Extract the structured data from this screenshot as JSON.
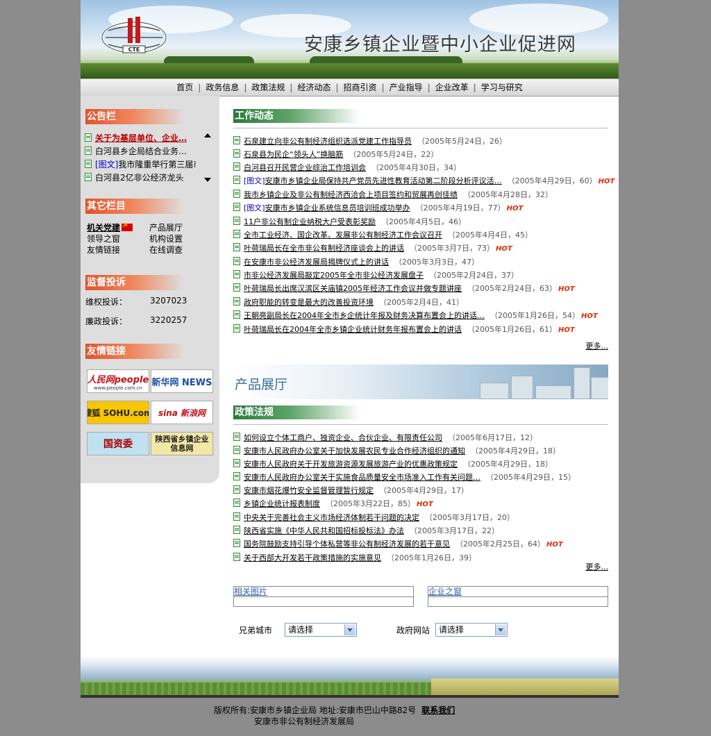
{
  "header": {
    "site_title": "安康乡镇企业暨中小企业促进网",
    "logo_text": "CTE"
  },
  "nav": [
    "首页",
    "政务信息",
    "政策法规",
    "经济动态",
    "招商引资",
    "产业指导",
    "企业改革",
    "学习与研究"
  ],
  "sidebar": {
    "notice_title": "公告栏",
    "notices": [
      {
        "tag": "",
        "text": "关于为基层单位、企业…",
        "highlight": true
      },
      {
        "tag": "",
        "text": "白河县乡企局结合业务…",
        "highlight": false
      },
      {
        "tag": "[图文]",
        "text": "我市隆重举行第三届市…",
        "highlight": false
      },
      {
        "tag": "",
        "text": "白河县2亿非公经济龙头",
        "highlight": false
      }
    ],
    "other_title": "其它栏目",
    "other_links": [
      "机关党建",
      "产品展厅",
      "领导之窗",
      "机构设置",
      "友情链接",
      "在线调查"
    ],
    "supervise_title": "监督投诉",
    "supervise": [
      {
        "label": "维权投诉：",
        "value": "3207023"
      },
      {
        "label": "廉政投诉：",
        "value": "3220257"
      }
    ],
    "friend_title": "友情链接",
    "friend_links": [
      "人民网people",
      "新华网 NEWS",
      "搜狐 SOHU.com",
      "sina 新浪网",
      "国资委",
      "陕西省乡镇企业信息网"
    ],
    "friend_sub": [
      "www.people.com.cn"
    ]
  },
  "economy": {
    "title": "工作动态",
    "items": [
      {
        "tag": "",
        "title": "石泉建立向非公有制经济组织选派党建工作指导员",
        "meta": "（2005年5月24日，26）",
        "hot": false
      },
      {
        "tag": "",
        "title": "石泉县为民企“领头人”换脑筋",
        "meta": "（2005年5月24日，22）",
        "hot": false
      },
      {
        "tag": "",
        "title": "白河县召开民营企业综治工作培训会",
        "meta": "（2005年4月30日，34）",
        "hot": false
      },
      {
        "tag": "[图文]",
        "title": "安康市乡镇企业局保持共产党员先进性教育活动第二阶段分析评议活…",
        "meta": "（2005年4月29日，60）",
        "hot": true
      },
      {
        "tag": "",
        "title": "我市乡镇企业及非公有制经济西洽会上项目签约和贸展再创佳绩",
        "meta": "（2005年4月28日，32）",
        "hot": false
      },
      {
        "tag": "[图文]",
        "title": "安康市乡镇企业系统信息员培训班成功举办",
        "meta": "（2005年4月19日，77）",
        "hot": true
      },
      {
        "tag": "",
        "title": "11户非公有制企业纳税大户受表彰奖励",
        "meta": "（2005年4月5日，46）",
        "hot": false
      },
      {
        "tag": "",
        "title": "全市工业经济、国企改革、发展非公有制经济工作会议召开",
        "meta": "（2005年4月4日，45）",
        "hot": false
      },
      {
        "tag": "",
        "title": "叶荷瑞局长在全市非公有制经济座谈会上的讲话",
        "meta": "（2005年3月7日，73）",
        "hot": true
      },
      {
        "tag": "",
        "title": "在安康市非公经济发展局揭牌仪式上的讲话",
        "meta": "（2005年3月3日，47）",
        "hot": false
      },
      {
        "tag": "",
        "title": "市非公经济发展局敲定2005年全市非公经济发展盘子",
        "meta": "（2005年2月24日，37）",
        "hot": false
      },
      {
        "tag": "",
        "title": "叶荷瑞局长出席汉滨区关庙镇2005年经济工作会议并做专题讲座",
        "meta": "（2005年2月24日，63）",
        "hot": true
      },
      {
        "tag": "",
        "title": "政府职能的转变是最大的改善投资环境",
        "meta": "（2005年2月4日，41）",
        "hot": false
      },
      {
        "tag": "",
        "title": "王朝亮副局长在2004年全市乡企统计年报及财务决算布置会上的讲话…",
        "meta": "（2005年1月26日，54）",
        "hot": true
      },
      {
        "tag": "",
        "title": "叶荷瑞局长在2004年全市乡镇企业统计财务年报布置会上的讲话",
        "meta": "（2005年1月26日，61）",
        "hot": true
      }
    ],
    "more": "更多..."
  },
  "product": {
    "title": "产品展厅"
  },
  "policy": {
    "title": "政策法规",
    "items": [
      {
        "title": "如何设立个体工商户、独资企业、合伙企业、有限责任公司",
        "meta": "（2005年6月17日，12）",
        "hot": false
      },
      {
        "title": "安康市人民政府办公室关于加快发展农民专业合作经济组织的通知",
        "meta": "（2005年4月29日，18）",
        "hot": false
      },
      {
        "title": "安康市人民政府关于开发旅游资源发展旅游产业的优惠政策规定",
        "meta": "（2005年4月29日，18）",
        "hot": false
      },
      {
        "title": "安康市人民政府办公室关于实施食品质量安全市场准入工作有关问题…",
        "meta": "（2005年4月29日，15）",
        "hot": false
      },
      {
        "title": "安康市烟花爆竹安全监督管理暂行规定",
        "meta": "（2005年4月29日，17）",
        "hot": false
      },
      {
        "title": "乡镇企业统计报表制度",
        "meta": "（2005年3月22日，85）",
        "hot": true
      },
      {
        "title": "中央关于完善社会主义市场经济体制若干问题的决定",
        "meta": "（2005年3月17日，20）",
        "hot": false
      },
      {
        "title": "陕西省实施《中华人民共和国招标投标法》办法",
        "meta": "（2005年3月17日，22）",
        "hot": false
      },
      {
        "title": "国务院鼓励支持引导个体私营等非公有制经济发展的若干意见",
        "meta": "（2005年2月25日，64）",
        "hot": true
      },
      {
        "title": "关于西部大开发若干政策措施的实施意见",
        "meta": "（2005年1月26日，39）",
        "hot": false
      }
    ],
    "more": "更多..."
  },
  "boxes": [
    "相关图片",
    "企业之窗"
  ],
  "selects": [
    {
      "label": "兄弟城市",
      "value": "请选择"
    },
    {
      "label": "政府网站",
      "value": "请选择"
    }
  ],
  "hot_label": "HOT",
  "footer": {
    "line1": "版权所有:安康市乡镇企业局   地址:安康市巴山中路82号",
    "contact": "联系我们",
    "line2": "安康市非公有制经济发展局"
  }
}
